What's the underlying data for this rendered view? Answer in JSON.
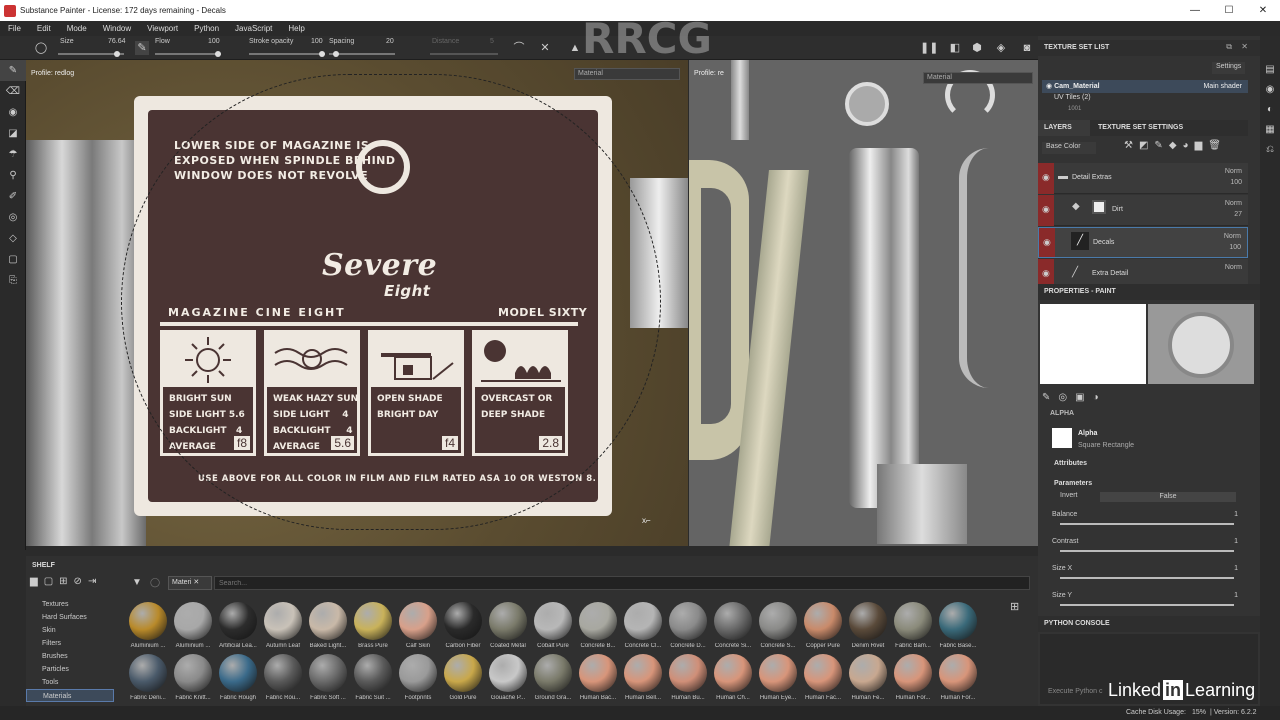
{
  "window": {
    "title": "Substance Painter - License: 172 days remaining - Decals"
  },
  "menu": [
    "File",
    "Edit",
    "Mode",
    "Window",
    "Viewport",
    "Python",
    "JavaScript",
    "Help"
  ],
  "toolbar": {
    "size_label": "Size",
    "size_value": "76.64",
    "flow_label": "Flow",
    "flow_value": "100",
    "stroke_label": "Stroke opacity",
    "stroke_value": "100",
    "spacing_label": "Spacing",
    "spacing_value": "20",
    "distance_label": "Distance",
    "distance_value": "5"
  },
  "viewport3d": {
    "profile": "Profile: redlog",
    "material_dd": "Material"
  },
  "viewport2d": {
    "profile": "Profile: re",
    "material_dd": "Material"
  },
  "plate": {
    "top_text_1": "LOWER SIDE OF MAGAZINE IS",
    "top_text_2": "EXPOSED WHEN SPINDLE BEHIND",
    "top_text_3": "WINDOW DOES NOT REVOLVE",
    "brand": "Severe",
    "brand_sub": "Eight",
    "left_caption": "MAGAZINE CINE EIGHT",
    "right_caption": "MODEL SIXTY",
    "cells": [
      {
        "text": "BRIGHT SUN\nSIDE LIGHT 5.6\nBACKLIGHT   4\nAVERAGE",
        "fstop": "f8"
      },
      {
        "text": "WEAK HAZY SUN\nSIDE LIGHT    4\nBACKLIGHT     4\nAVERAGE",
        "fstop": "5.6"
      },
      {
        "text": "OPEN SHADE\nBRIGHT DAY",
        "fstop": "f4"
      },
      {
        "text": "OVERCAST OR\nDEEP SHADE",
        "fstop": "2.8"
      }
    ],
    "bottom_text": "USE ABOVE FOR ALL COLOR IN FILM AND FILM RATED ASA 10 OR WESTON 8."
  },
  "texture_set_list": {
    "title": "TEXTURE SET LIST",
    "settings": "Settings",
    "material": "Cam_Material",
    "shader": "Main shader",
    "uv_tiles": "UV Tiles (2)",
    "uv_item": "1001"
  },
  "layers": {
    "tab_layers": "LAYERS",
    "tab_tss": "TEXTURE SET SETTINGS",
    "channel": "Base Color",
    "items": [
      {
        "name": "Detail Extras",
        "blend": "Norm",
        "opacity": "100"
      },
      {
        "name": "Dirt",
        "blend": "Norm",
        "opacity": "27"
      },
      {
        "name": "Decals",
        "blend": "Norm",
        "opacity": "100"
      },
      {
        "name": "Extra Detail",
        "blend": "Norm",
        "opacity": ""
      }
    ]
  },
  "properties": {
    "title": "PROPERTIES - PAINT",
    "alpha_section": "ALPHA",
    "alpha_label": "Alpha",
    "alpha_value": "Square Rectangle",
    "attributes": "Attributes",
    "parameters": "Parameters",
    "invert_label": "Invert",
    "invert_value": "False",
    "params": [
      {
        "label": "Balance",
        "value": "1"
      },
      {
        "label": "Contrast",
        "value": "1"
      },
      {
        "label": "Size X",
        "value": "1"
      },
      {
        "label": "Size Y",
        "value": "1"
      }
    ]
  },
  "python_console": {
    "title": "PYTHON CONSOLE",
    "hint": "Execute Python c"
  },
  "shelf": {
    "title": "SHELF",
    "filter_tag": "Materi",
    "search_placeholder": "Search...",
    "categories": [
      "Textures",
      "Hard Surfaces",
      "Skin",
      "Filters",
      "Brushes",
      "Particles",
      "Tools",
      "Materials"
    ],
    "materials_row1": [
      {
        "name": "Aluminium ...",
        "color": "#b98a2a"
      },
      {
        "name": "Aluminium ...",
        "color": "#a8a8a8"
      },
      {
        "name": "Artificial Lea...",
        "color": "#2c2c2c"
      },
      {
        "name": "Autumn Leaf",
        "color": "#c9c2b8"
      },
      {
        "name": "Baked Light...",
        "color": "#c9b9a8"
      },
      {
        "name": "Brass Pure",
        "color": "#c9b25a"
      },
      {
        "name": "Calf Skin",
        "color": "#d8a08a"
      },
      {
        "name": "Carbon Fiber",
        "color": "#2a2a2a"
      },
      {
        "name": "Coated Metal",
        "color": "#7a7a6a"
      },
      {
        "name": "Cobalt Pure",
        "color": "#b8b8b8"
      },
      {
        "name": "Concrete B...",
        "color": "#a8a8a0"
      },
      {
        "name": "Concrete Cl...",
        "color": "#b5b5b5"
      },
      {
        "name": "Concrete D...",
        "color": "#8a8a8a"
      },
      {
        "name": "Concrete Si...",
        "color": "#6a6a6a"
      },
      {
        "name": "Concrete S...",
        "color": "#8a8a88"
      },
      {
        "name": "Copper Pure",
        "color": "#c98a6a"
      },
      {
        "name": "Denim Rivet",
        "color": "#5a4a3a"
      },
      {
        "name": "Fabric Bam...",
        "color": "#8a8a7a"
      },
      {
        "name": "Fabric Base...",
        "color": "#3a6a7a"
      }
    ],
    "materials_row2": [
      {
        "name": "Fabric Deni...",
        "color": "#4a5a6a"
      },
      {
        "name": "Fabric Knitt...",
        "color": "#8a8a8a"
      },
      {
        "name": "Fabric Rough",
        "color": "#3a6a8a"
      },
      {
        "name": "Fabric Rou...",
        "color": "#5a5a5a"
      },
      {
        "name": "Fabric Soft ...",
        "color": "#6a6a6a"
      },
      {
        "name": "Fabric Suit ...",
        "color": "#5a5a5a"
      },
      {
        "name": "Footprints",
        "color": "#9a9a9a"
      },
      {
        "name": "Gold Pure",
        "color": "#c9a84a"
      },
      {
        "name": "Gouache P...",
        "color": "#c8c8c8"
      },
      {
        "name": "Ground Gra...",
        "color": "#7a7a6a"
      },
      {
        "name": "Human Bac...",
        "color": "#d8957a"
      },
      {
        "name": "Human Bell...",
        "color": "#d8957a"
      },
      {
        "name": "Human Bu...",
        "color": "#d08f78"
      },
      {
        "name": "Human Ch...",
        "color": "#d8957a"
      },
      {
        "name": "Human Eye...",
        "color": "#d8957a"
      },
      {
        "name": "Human Fac...",
        "color": "#d8957a"
      },
      {
        "name": "Human Fe...",
        "color": "#c8a890"
      },
      {
        "name": "Human For...",
        "color": "#d8957a"
      },
      {
        "name": "Human For...",
        "color": "#d8957a"
      }
    ]
  },
  "status": {
    "cache": "Cache Disk Usage:",
    "pct": "15%",
    "version": "| Version: 6.2.2"
  },
  "watermark": {
    "rrcg": "RRCG",
    "linkedin": "Linked",
    "in": "in",
    "learning": "Learning"
  }
}
